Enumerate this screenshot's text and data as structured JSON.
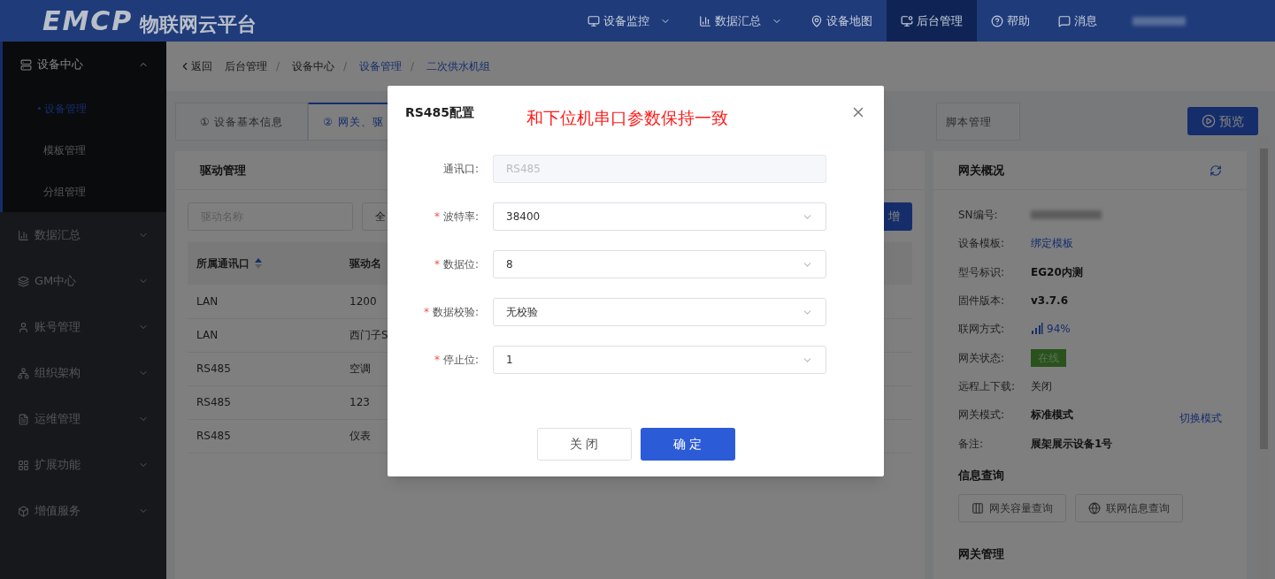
{
  "header": {
    "logo_mark": "EMCP",
    "logo_text": "物联网云平台",
    "nav": [
      {
        "label": "设备监控",
        "dropdown": true,
        "selected": false
      },
      {
        "label": "数据汇总",
        "dropdown": true,
        "selected": false
      },
      {
        "label": "设备地图",
        "dropdown": false,
        "selected": false
      },
      {
        "label": "后台管理",
        "dropdown": false,
        "selected": true
      },
      {
        "label": "帮助",
        "dropdown": false,
        "selected": false
      },
      {
        "label": "消息",
        "dropdown": false,
        "selected": false
      }
    ]
  },
  "sidebar": {
    "items": [
      {
        "label": "设备中心",
        "expanded": true,
        "children": [
          {
            "label": "设备管理",
            "selected": true
          },
          {
            "label": "模板管理",
            "selected": false
          },
          {
            "label": "分组管理",
            "selected": false
          }
        ]
      },
      {
        "label": "数据汇总",
        "expanded": false
      },
      {
        "label": "GM中心",
        "expanded": false
      },
      {
        "label": "账号管理",
        "expanded": false
      },
      {
        "label": "组织架构",
        "expanded": false
      },
      {
        "label": "运维管理",
        "expanded": false
      },
      {
        "label": "扩展功能",
        "expanded": false
      },
      {
        "label": "增值服务",
        "expanded": false
      }
    ]
  },
  "breadcrumb": {
    "back": "返回",
    "separator": "/",
    "items": [
      {
        "label": "后台管理",
        "link": false
      },
      {
        "label": "设备中心",
        "link": false
      },
      {
        "label": "设备管理",
        "link": true
      },
      {
        "label": "二次供水机组",
        "link": true
      }
    ]
  },
  "tabs": [
    {
      "label": "① 设备基本信息",
      "selected": false
    },
    {
      "label": "② 网关、驱",
      "selected": true
    },
    {
      "label": "脚本管理",
      "selected": false
    }
  ],
  "preview_button": "预览",
  "driver_panel": {
    "title": "驱动管理",
    "search": {
      "placeholder": "驱动名称"
    },
    "filter": "全",
    "add_button": "增",
    "table": {
      "columns": [
        "所属通讯口",
        "驱动名"
      ],
      "rows": [
        [
          "LAN",
          "1200"
        ],
        [
          "LAN",
          "西门子S"
        ],
        [
          "RS485",
          "空调"
        ],
        [
          "RS485",
          "123"
        ],
        [
          "RS485",
          "仪表"
        ]
      ]
    }
  },
  "gateway_panel": {
    "title": "网关概况",
    "rows": [
      {
        "label": "SN编号:",
        "kind": "redacted"
      },
      {
        "label": "设备模板:",
        "kind": "link",
        "value": "绑定模板"
      },
      {
        "label": "型号标识:",
        "kind": "bold",
        "value": "EG20内测"
      },
      {
        "label": "固件版本:",
        "kind": "bold",
        "value": "v3.7.6"
      },
      {
        "label": "联网方式:",
        "kind": "signal",
        "value": "94%"
      },
      {
        "label": "网关状态:",
        "kind": "tag",
        "value": "在线"
      },
      {
        "label": "远程上下载:",
        "kind": "text",
        "value": "关闭"
      },
      {
        "label": "网关模式:",
        "kind": "bold",
        "value": "标准模式",
        "action": "切换模式"
      },
      {
        "label": "备注:",
        "kind": "bold",
        "value": "展架展示设备1号"
      }
    ],
    "query_title": "信息查询",
    "query_buttons": [
      "网关容量查询",
      "联网信息查询"
    ],
    "manage_title": "网关管理"
  },
  "dialog": {
    "title": "RS485配置",
    "note": "和下位机串口参数保持一致",
    "required_mark": "*",
    "fields": [
      {
        "label": "通讯口:",
        "value": "RS485",
        "required": false,
        "disabled": true
      },
      {
        "label": "波特率:",
        "value": "38400",
        "required": true,
        "disabled": false
      },
      {
        "label": "数据位:",
        "value": "8",
        "required": true,
        "disabled": false
      },
      {
        "label": "数据校验:",
        "value": "无校验",
        "required": true,
        "disabled": false
      },
      {
        "label": "停止位:",
        "value": "1",
        "required": true,
        "disabled": false
      }
    ],
    "buttons": [
      {
        "label": "关 闭",
        "primary": false
      },
      {
        "label": "确 定",
        "primary": true
      }
    ]
  }
}
